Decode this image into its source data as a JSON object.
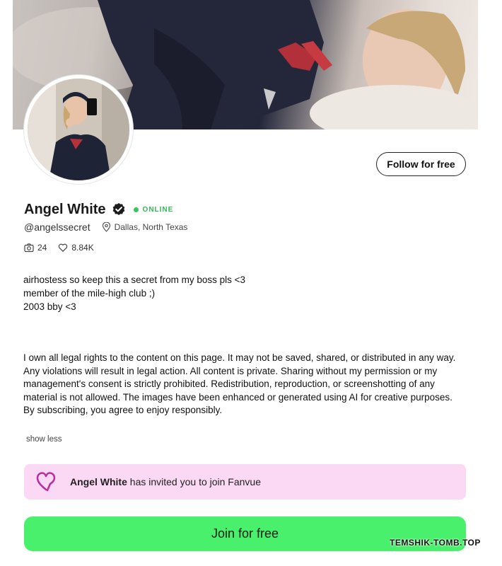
{
  "profile": {
    "name": "Angel White",
    "status": "ONLINE",
    "handle": "@angelssecret",
    "location": "Dallas, North Texas",
    "photos_count": "24",
    "likes_count": "8.84K",
    "follow_label": "Follow for free",
    "verified_icon": "verified-check-icon",
    "status_color": "#31c95c"
  },
  "bio": {
    "lines": [
      "airhostess so keep this a secret from my boss pls <3",
      "member of the mile-high club ;)",
      "2003 bby <3"
    ],
    "legal": "I own all legal rights to the content on this page. It may not be saved, shared, or distributed in any way. Any violations will result in legal action. All content is private. Sharing without my permission or my management's consent is strictly prohibited. Redistribution, reproduction, or screenshotting of any material is not allowed. The images have been enhanced or generated using AI for creative purposes. By subscribing, you agree to enjoy responsibly.",
    "toggle_label": "show less"
  },
  "invite": {
    "name": "Angel White",
    "text": "has invited you to join Fanvue",
    "background": "#fbd9f4",
    "icon": "fanvue-heart-icon"
  },
  "cta": {
    "join_label": "Join for free",
    "color": "#49f06c"
  },
  "watermark": {
    "text": "TEMSHIK-TOMB.TOP"
  }
}
